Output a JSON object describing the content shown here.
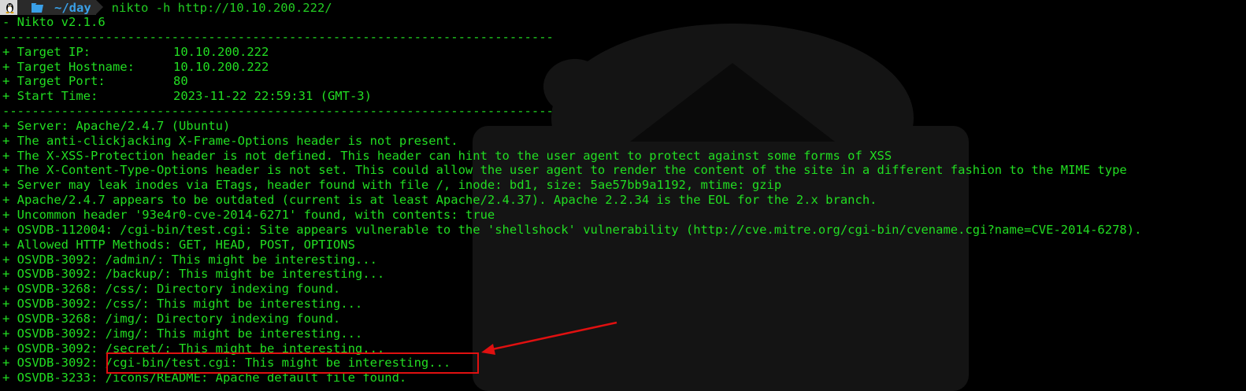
{
  "prompt": {
    "os_icon": "linux-tux-icon",
    "dir_icon": "folder-icon",
    "directory": "~/day",
    "command": "nikto -h http://10.10.200.222/"
  },
  "output": {
    "version": "- Nikto v2.1.6",
    "separator": "---------------------------------------------------------------------------",
    "target_info": [
      {
        "label": "+ Target IP:",
        "value": "10.10.200.222"
      },
      {
        "label": "+ Target Hostname:",
        "value": "10.10.200.222"
      },
      {
        "label": "+ Target Port:",
        "value": "80"
      },
      {
        "label": "+ Start Time:",
        "value": "2023-11-22 22:59:31 (GMT-3)"
      }
    ],
    "findings": [
      "+ Server: Apache/2.4.7 (Ubuntu)",
      "+ The anti-clickjacking X-Frame-Options header is not present.",
      "+ The X-XSS-Protection header is not defined. This header can hint to the user agent to protect against some forms of XSS",
      "+ The X-Content-Type-Options header is not set. This could allow the user agent to render the content of the site in a different fashion to the MIME type",
      "+ Server may leak inodes via ETags, header found with file /, inode: bd1, size: 5ae57bb9a1192, mtime: gzip",
      "+ Apache/2.4.7 appears to be outdated (current is at least Apache/2.4.37). Apache 2.2.34 is the EOL for the 2.x branch.",
      "+ Uncommon header '93e4r0-cve-2014-6271' found, with contents: true",
      "+ OSVDB-112004: /cgi-bin/test.cgi: Site appears vulnerable to the 'shellshock' vulnerability (http://cve.mitre.org/cgi-bin/cvename.cgi?name=CVE-2014-6278).",
      "+ Allowed HTTP Methods: GET, HEAD, POST, OPTIONS",
      "+ OSVDB-3092: /admin/: This might be interesting...",
      "+ OSVDB-3092: /backup/: This might be interesting...",
      "+ OSVDB-3268: /css/: Directory indexing found.",
      "+ OSVDB-3092: /css/: This might be interesting...",
      "+ OSVDB-3268: /img/: Directory indexing found.",
      "+ OSVDB-3092: /img/: This might be interesting...",
      "+ OSVDB-3092: /secret/: This might be interesting...",
      "+ OSVDB-3092: /cgi-bin/test.cgi: This might be interesting...",
      "+ OSVDB-3233: /icons/README: Apache default file found."
    ]
  },
  "annotation": {
    "highlight_color": "#e01010",
    "highlighted_text": "/cgi-bin/test.cgi: This might be interesting..."
  },
  "colors": {
    "text": "#22dd22",
    "background": "#000000",
    "dir": "#3aa0e8"
  }
}
